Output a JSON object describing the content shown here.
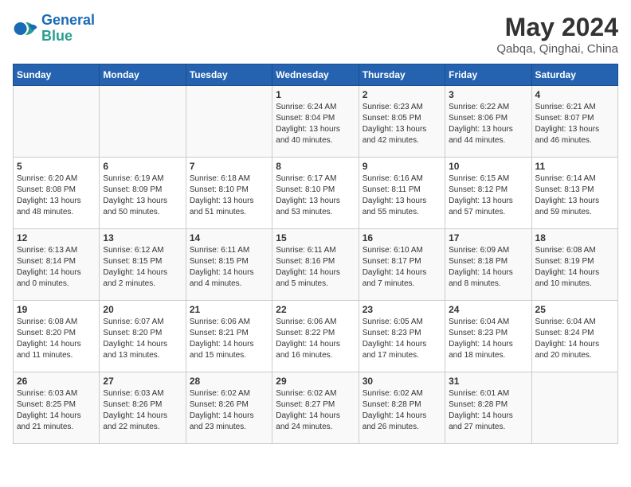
{
  "logo": {
    "line1": "General",
    "line2": "Blue"
  },
  "title": "May 2024",
  "subtitle": "Qabqa, Qinghai, China",
  "weekdays": [
    "Sunday",
    "Monday",
    "Tuesday",
    "Wednesday",
    "Thursday",
    "Friday",
    "Saturday"
  ],
  "weeks": [
    [
      {
        "day": "",
        "sunrise": "",
        "sunset": "",
        "daylight": ""
      },
      {
        "day": "",
        "sunrise": "",
        "sunset": "",
        "daylight": ""
      },
      {
        "day": "",
        "sunrise": "",
        "sunset": "",
        "daylight": ""
      },
      {
        "day": "1",
        "sunrise": "6:24 AM",
        "sunset": "8:04 PM",
        "daylight": "13 hours and 40 minutes."
      },
      {
        "day": "2",
        "sunrise": "6:23 AM",
        "sunset": "8:05 PM",
        "daylight": "13 hours and 42 minutes."
      },
      {
        "day": "3",
        "sunrise": "6:22 AM",
        "sunset": "8:06 PM",
        "daylight": "13 hours and 44 minutes."
      },
      {
        "day": "4",
        "sunrise": "6:21 AM",
        "sunset": "8:07 PM",
        "daylight": "13 hours and 46 minutes."
      }
    ],
    [
      {
        "day": "5",
        "sunrise": "6:20 AM",
        "sunset": "8:08 PM",
        "daylight": "13 hours and 48 minutes."
      },
      {
        "day": "6",
        "sunrise": "6:19 AM",
        "sunset": "8:09 PM",
        "daylight": "13 hours and 50 minutes."
      },
      {
        "day": "7",
        "sunrise": "6:18 AM",
        "sunset": "8:10 PM",
        "daylight": "13 hours and 51 minutes."
      },
      {
        "day": "8",
        "sunrise": "6:17 AM",
        "sunset": "8:10 PM",
        "daylight": "13 hours and 53 minutes."
      },
      {
        "day": "9",
        "sunrise": "6:16 AM",
        "sunset": "8:11 PM",
        "daylight": "13 hours and 55 minutes."
      },
      {
        "day": "10",
        "sunrise": "6:15 AM",
        "sunset": "8:12 PM",
        "daylight": "13 hours and 57 minutes."
      },
      {
        "day": "11",
        "sunrise": "6:14 AM",
        "sunset": "8:13 PM",
        "daylight": "13 hours and 59 minutes."
      }
    ],
    [
      {
        "day": "12",
        "sunrise": "6:13 AM",
        "sunset": "8:14 PM",
        "daylight": "14 hours and 0 minutes."
      },
      {
        "day": "13",
        "sunrise": "6:12 AM",
        "sunset": "8:15 PM",
        "daylight": "14 hours and 2 minutes."
      },
      {
        "day": "14",
        "sunrise": "6:11 AM",
        "sunset": "8:15 PM",
        "daylight": "14 hours and 4 minutes."
      },
      {
        "day": "15",
        "sunrise": "6:11 AM",
        "sunset": "8:16 PM",
        "daylight": "14 hours and 5 minutes."
      },
      {
        "day": "16",
        "sunrise": "6:10 AM",
        "sunset": "8:17 PM",
        "daylight": "14 hours and 7 minutes."
      },
      {
        "day": "17",
        "sunrise": "6:09 AM",
        "sunset": "8:18 PM",
        "daylight": "14 hours and 8 minutes."
      },
      {
        "day": "18",
        "sunrise": "6:08 AM",
        "sunset": "8:19 PM",
        "daylight": "14 hours and 10 minutes."
      }
    ],
    [
      {
        "day": "19",
        "sunrise": "6:08 AM",
        "sunset": "8:20 PM",
        "daylight": "14 hours and 11 minutes."
      },
      {
        "day": "20",
        "sunrise": "6:07 AM",
        "sunset": "8:20 PM",
        "daylight": "14 hours and 13 minutes."
      },
      {
        "day": "21",
        "sunrise": "6:06 AM",
        "sunset": "8:21 PM",
        "daylight": "14 hours and 15 minutes."
      },
      {
        "day": "22",
        "sunrise": "6:06 AM",
        "sunset": "8:22 PM",
        "daylight": "14 hours and 16 minutes."
      },
      {
        "day": "23",
        "sunrise": "6:05 AM",
        "sunset": "8:23 PM",
        "daylight": "14 hours and 17 minutes."
      },
      {
        "day": "24",
        "sunrise": "6:04 AM",
        "sunset": "8:23 PM",
        "daylight": "14 hours and 18 minutes."
      },
      {
        "day": "25",
        "sunrise": "6:04 AM",
        "sunset": "8:24 PM",
        "daylight": "14 hours and 20 minutes."
      }
    ],
    [
      {
        "day": "26",
        "sunrise": "6:03 AM",
        "sunset": "8:25 PM",
        "daylight": "14 hours and 21 minutes."
      },
      {
        "day": "27",
        "sunrise": "6:03 AM",
        "sunset": "8:26 PM",
        "daylight": "14 hours and 22 minutes."
      },
      {
        "day": "28",
        "sunrise": "6:02 AM",
        "sunset": "8:26 PM",
        "daylight": "14 hours and 23 minutes."
      },
      {
        "day": "29",
        "sunrise": "6:02 AM",
        "sunset": "8:27 PM",
        "daylight": "14 hours and 24 minutes."
      },
      {
        "day": "30",
        "sunrise": "6:02 AM",
        "sunset": "8:28 PM",
        "daylight": "14 hours and 26 minutes."
      },
      {
        "day": "31",
        "sunrise": "6:01 AM",
        "sunset": "8:28 PM",
        "daylight": "14 hours and 27 minutes."
      },
      {
        "day": "",
        "sunrise": "",
        "sunset": "",
        "daylight": ""
      }
    ]
  ]
}
